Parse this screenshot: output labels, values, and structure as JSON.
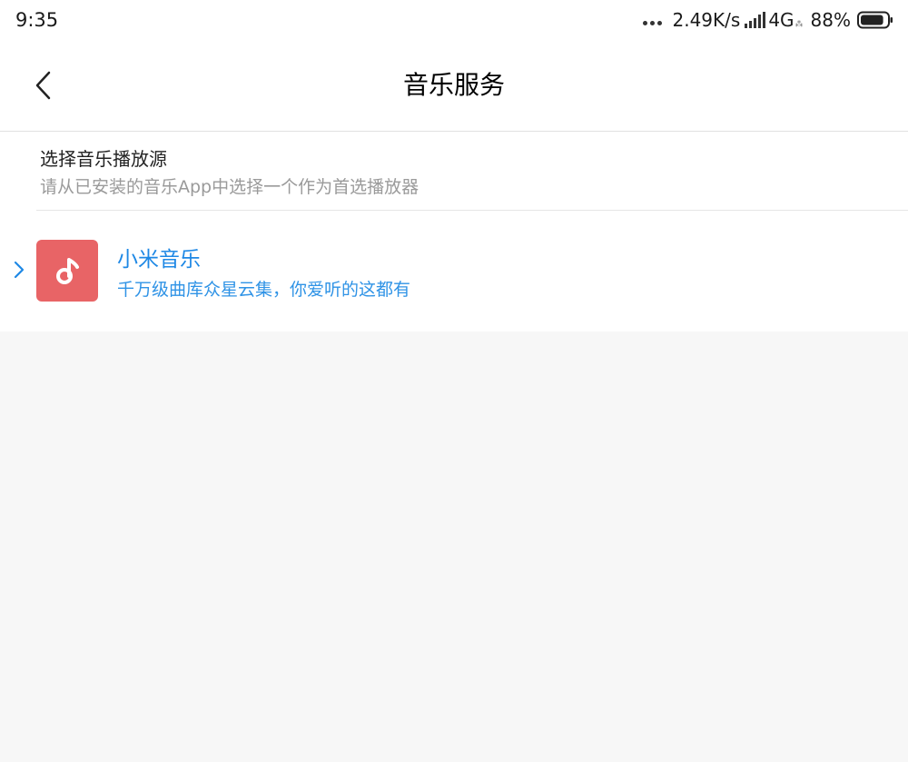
{
  "status_bar": {
    "time": "9:35",
    "net_speed": "2.49K/s",
    "network_type": "4G",
    "hd_mark": "⁂",
    "battery_percent": "88%",
    "battery_level": 0.88,
    "icons": [
      "more-dots-icon",
      "signal-icon",
      "battery-icon"
    ]
  },
  "header": {
    "title": "音乐服务",
    "back_icon": "chevron-left-icon"
  },
  "section": {
    "title": "选择音乐播放源",
    "subtitle": "请从已安装的音乐App中选择一个作为首选播放器"
  },
  "apps": [
    {
      "name": "小米音乐",
      "description": "千万级曲库众星云集，你爱听的这都有",
      "icon": "music-note-icon",
      "icon_bg": "#e86466",
      "selected": true
    }
  ],
  "colors": {
    "accent": "#1e88e5",
    "background": "#f7f7f7",
    "surface": "#ffffff"
  }
}
